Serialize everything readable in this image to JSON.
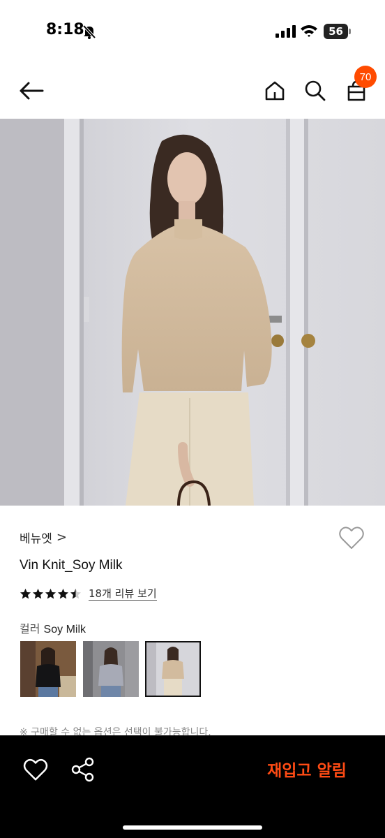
{
  "status_bar": {
    "time": "8:18",
    "battery": "56"
  },
  "nav": {
    "cart_count": "70"
  },
  "product": {
    "brand": "베뉴엣",
    "brand_chevron": ">",
    "name": "Vin Knit_Soy Milk",
    "rating": 4.5,
    "review_link": "18개 리뷰 보기",
    "color_label": "컬러",
    "color_value": "Soy Milk",
    "swatches": [
      "black",
      "gray",
      "soy-milk"
    ],
    "selected_swatch": "soy-milk",
    "notice": "※ 구매할 수 없는 옵션은 선택이 불가능합니다."
  },
  "bottom_bar": {
    "restock_label": "재입고 알림"
  },
  "colors": {
    "accent": "#ff4b00",
    "restock": "#ff4b14",
    "bar": "#000000"
  }
}
